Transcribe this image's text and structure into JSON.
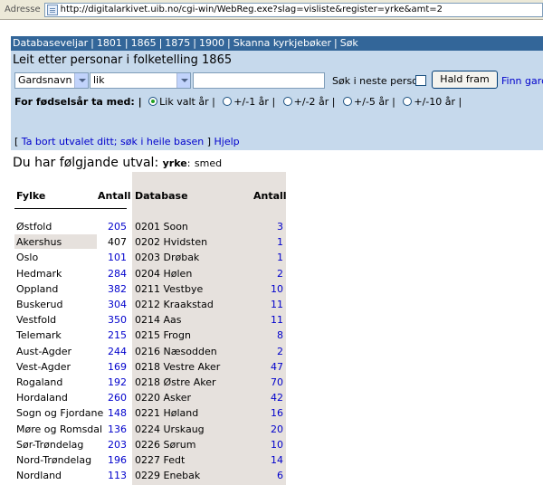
{
  "address_bar": {
    "label": "Adresse",
    "url": "http://digitalarkivet.uib.no/cgi-win/WebReg.exe?slag=visliste&register=yrke&amt=2"
  },
  "nav": {
    "items": [
      "Databaseveljar",
      "1801",
      "1865",
      "1875",
      "1900",
      "Skanna kyrkjebøker",
      "Søk"
    ],
    "separator": "|"
  },
  "search": {
    "title": "Leit etter personar i folketelling 1865",
    "field_select": "Gardsnavn",
    "op_select": "lik",
    "value": "",
    "next_person_label": "Søk i neste person",
    "hold_button": "Hald fram",
    "find_link": "Finn gardar",
    "birth_year_label": "For fødselsår ta med: |",
    "radios": [
      {
        "label": "Lik valt år |",
        "checked": true
      },
      {
        "label": "+/-1 år |",
        "checked": false
      },
      {
        "label": "+/-2 år |",
        "checked": false
      },
      {
        "label": "+/-5 år |",
        "checked": false
      },
      {
        "label": "+/-10 år |",
        "checked": false
      }
    ],
    "remove_selection": "Ta bort utvalet ditt; søk i heile basen",
    "help": "Hjelp",
    "bracket_open": "[",
    "bracket_close": "]"
  },
  "selection": {
    "heading": "Du har følgjande utval:",
    "key": "yrke",
    "value": "smed"
  },
  "county_table": {
    "header_name": "Fylke",
    "header_count": "Antall",
    "rows": [
      {
        "name": "Østfold",
        "count": "205",
        "link": true
      },
      {
        "name": "Akershus",
        "count": "407",
        "link": false
      },
      {
        "name": "Oslo",
        "count": "101",
        "link": true
      },
      {
        "name": "Hedmark",
        "count": "284",
        "link": true
      },
      {
        "name": "Oppland",
        "count": "382",
        "link": true
      },
      {
        "name": "Buskerud",
        "count": "304",
        "link": true
      },
      {
        "name": "Vestfold",
        "count": "350",
        "link": true
      },
      {
        "name": "Telemark",
        "count": "215",
        "link": true
      },
      {
        "name": "Aust-Agder",
        "count": "244",
        "link": true
      },
      {
        "name": "Vest-Agder",
        "count": "169",
        "link": true
      },
      {
        "name": "Rogaland",
        "count": "192",
        "link": true
      },
      {
        "name": "Hordaland",
        "count": "260",
        "link": true
      },
      {
        "name": "Sogn og Fjordane",
        "count": "148",
        "link": true
      },
      {
        "name": "Møre og Romsdal",
        "count": "136",
        "link": true
      },
      {
        "name": "Sør-Trøndelag",
        "count": "203",
        "link": true
      },
      {
        "name": "Nord-Trøndelag",
        "count": "196",
        "link": true
      },
      {
        "name": "Nordland",
        "count": "113",
        "link": true
      }
    ]
  },
  "database_table": {
    "header_name": "Database",
    "header_count": "Antall",
    "rows": [
      {
        "name": "0201 Soon",
        "count": "3"
      },
      {
        "name": "0202 Hvidsten",
        "count": "1"
      },
      {
        "name": "0203 Drøbak",
        "count": "1"
      },
      {
        "name": "0204 Hølen",
        "count": "2"
      },
      {
        "name": "0211 Vestbye",
        "count": "10"
      },
      {
        "name": "0212 Kraakstad",
        "count": "11"
      },
      {
        "name": "0214 Aas",
        "count": "11"
      },
      {
        "name": "0215 Frogn",
        "count": "8"
      },
      {
        "name": "0216 Næsodden",
        "count": "2"
      },
      {
        "name": "0218 Vestre Aker",
        "count": "47"
      },
      {
        "name": "0218 Østre Aker",
        "count": "70"
      },
      {
        "name": "0220 Asker",
        "count": "42"
      },
      {
        "name": "0221 Høland",
        "count": "16"
      },
      {
        "name": "0224 Urskaug",
        "count": "20"
      },
      {
        "name": "0226 Sørum",
        "count": "10"
      },
      {
        "name": "0227 Fedt",
        "count": "14"
      },
      {
        "name": "0229 Enebak",
        "count": "6"
      }
    ]
  }
}
